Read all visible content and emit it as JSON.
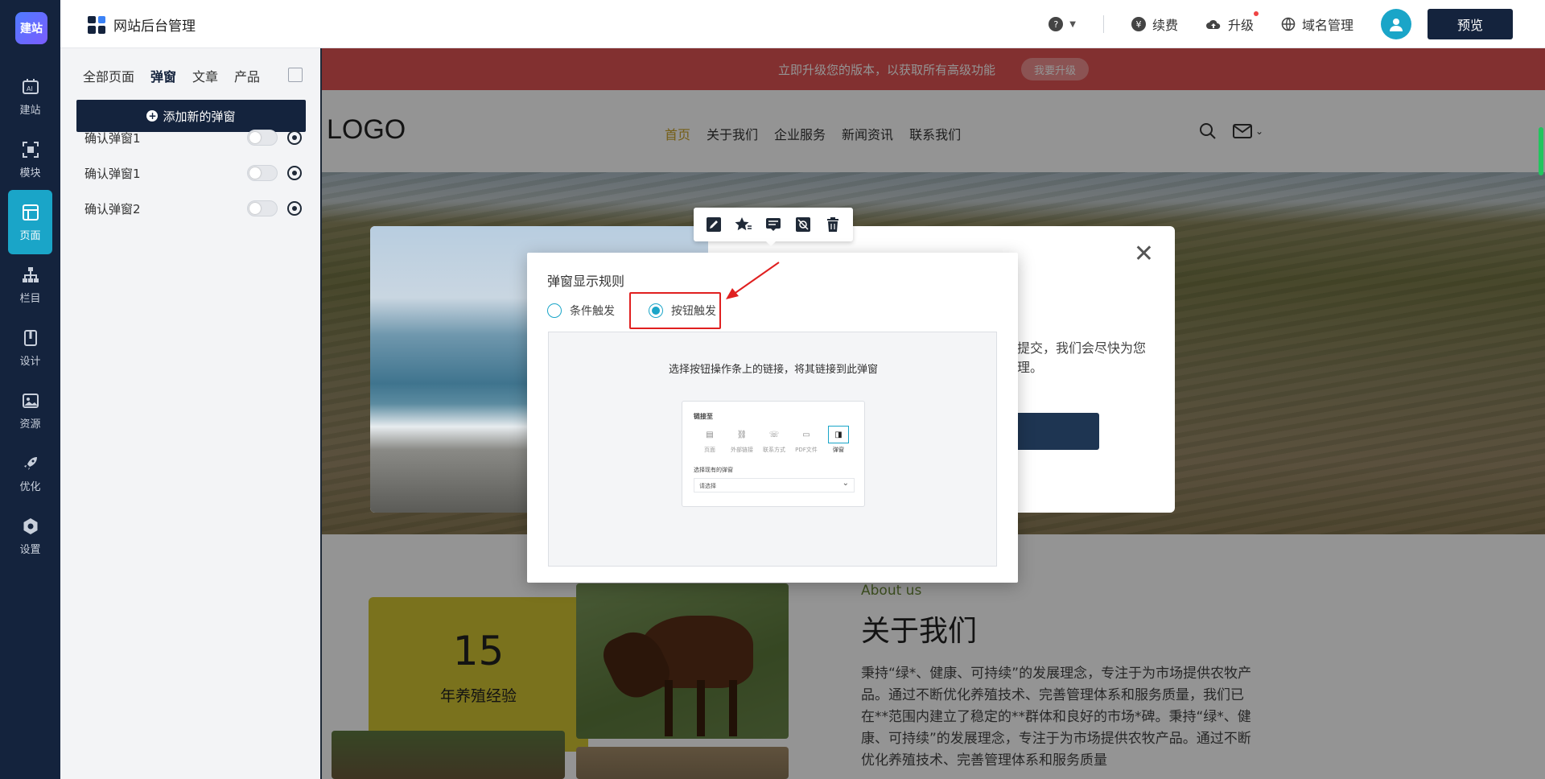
{
  "rail": {
    "logo": "建站",
    "items": [
      {
        "label": "建站",
        "icon": "ai-icon"
      },
      {
        "label": "模块",
        "icon": "module-icon"
      },
      {
        "label": "页面",
        "icon": "page-icon"
      },
      {
        "label": "栏目",
        "icon": "sitemap-icon"
      },
      {
        "label": "设计",
        "icon": "design-icon"
      },
      {
        "label": "资源",
        "icon": "image-icon"
      },
      {
        "label": "优化",
        "icon": "rocket-icon"
      },
      {
        "label": "设置",
        "icon": "gear-icon"
      }
    ],
    "active_index": 2
  },
  "topbar": {
    "title": "网站后台管理",
    "help": "?",
    "renew": "续费",
    "upgrade": "升级",
    "domain": "域名管理",
    "preview": "预览"
  },
  "panel": {
    "tabs": [
      "全部页面",
      "弹窗",
      "文章",
      "产品"
    ],
    "active_tab": 1,
    "add_button": "添加新的弹窗",
    "popups": [
      {
        "name": "确认弹窗1",
        "enabled": false
      },
      {
        "name": "确认弹窗1",
        "enabled": false
      },
      {
        "name": "确认弹窗2",
        "enabled": false
      }
    ]
  },
  "site": {
    "promo_text": "立即升级您的版本，以获取所有高级功能",
    "promo_button": "我要升级",
    "logo": "LOGO",
    "nav": [
      "首页",
      "关于我们",
      "企业服务",
      "新闻资讯",
      "联系我们"
    ],
    "about_sub": "About us",
    "about_title": "关于我们",
    "about_text": "秉持“绿*、健康、可持续”的发展理念，专注于为市场提供农牧产品。通过不断优化养殖技术、完善管理体系和服务质量，我们已在**范围内建立了稳定的**群体和良好的市场*碑。秉持“绿*、健康、可持续”的发展理念，专注于为市场提供农牧产品。通过不断优化养殖技术、完善管理体系和服务质量",
    "years_num": "15",
    "years_text": "年养殖经验",
    "popup_msg": "已提交，我们会尽快为您处理。"
  },
  "rules_dialog": {
    "title": "弹窗显示规则",
    "options": [
      "条件触发",
      "按钮触发"
    ],
    "selected": 1,
    "description": "选择按钮操作条上的链接，将其链接到此弹窗",
    "mini": {
      "title": "链接至",
      "options": [
        "页面",
        "外部链接",
        "联系方式",
        "PDF文件",
        "弹窗"
      ],
      "selected": 4,
      "select_label": "选择现有的弹窗",
      "select_placeholder": "请选择"
    }
  },
  "colors": {
    "rail_bg": "#14233d",
    "accent": "#1aa5c8",
    "promo": "#e05454",
    "highlight": "#e02020"
  }
}
